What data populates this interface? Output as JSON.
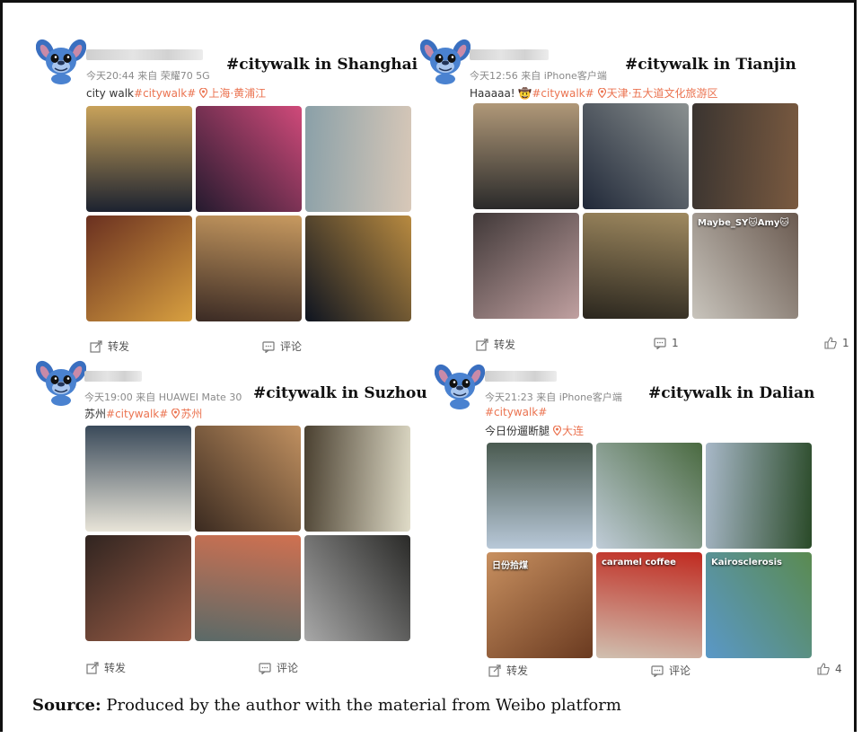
{
  "posts": [
    {
      "id": "shanghai",
      "title": "#citywalk in Shanghai",
      "meta": "今天20:44  来自 荣耀70 5G",
      "text_prefix": "city walk",
      "tag": "#citywalk#",
      "location": "上海·黄浦江",
      "photos": [
        {
          "colors": [
            "#1c2230",
            "#c8a25a"
          ],
          "caption": ""
        },
        {
          "colors": [
            "#241a2e",
            "#d04a7a"
          ],
          "caption": ""
        },
        {
          "colors": [
            "#8aa0a8",
            "#d8c8b8"
          ],
          "caption": ""
        },
        {
          "colors": [
            "#6a3020",
            "#d8a040"
          ],
          "caption": ""
        },
        {
          "colors": [
            "#3a2a24",
            "#c89a60"
          ],
          "caption": ""
        },
        {
          "colors": [
            "#0e1420",
            "#b88a40"
          ],
          "caption": ""
        }
      ],
      "actions": {
        "repost": "转发",
        "comment": "评论",
        "like": ""
      }
    },
    {
      "id": "tianjin",
      "title": "#citywalk in Tianjin",
      "meta": "今天12:56  来自 iPhone客户端",
      "text_prefix": "Haaaaa!  🤠",
      "tag": "#citywalk#",
      "location": "天津·五大道文化旅游区",
      "photos": [
        {
          "colors": [
            "#2a2a2a",
            "#b09878"
          ],
          "caption": ""
        },
        {
          "colors": [
            "#202838",
            "#8a9090"
          ],
          "caption": ""
        },
        {
          "colors": [
            "#3a3430",
            "#7a5a40"
          ],
          "caption": ""
        },
        {
          "colors": [
            "#403838",
            "#c0a0a0"
          ],
          "caption": ""
        },
        {
          "colors": [
            "#2a261e",
            "#a08a60"
          ],
          "caption": ""
        },
        {
          "colors": [
            "#c8c4bc",
            "#6a5a50"
          ],
          "caption": "Maybe_SY🐱Amy🐱"
        }
      ],
      "actions": {
        "repost": "转发",
        "comment": "1",
        "like": "1"
      }
    },
    {
      "id": "suzhou",
      "title": "#citywalk in Suzhou",
      "meta": "今天19:00  来自 HUAWEI Mate 30",
      "text_prefix": "苏州",
      "tag": "#citywalk#",
      "location": "苏州",
      "photos": [
        {
          "colors": [
            "#e8e4d8",
            "#3a4a5a"
          ],
          "caption": ""
        },
        {
          "colors": [
            "#3a2a20",
            "#c09060"
          ],
          "caption": ""
        },
        {
          "colors": [
            "#4a4030",
            "#e0dcc8"
          ],
          "caption": ""
        },
        {
          "colors": [
            "#302420",
            "#a06048"
          ],
          "caption": ""
        },
        {
          "colors": [
            "#5a6a68",
            "#d07050"
          ],
          "caption": ""
        },
        {
          "colors": [
            "#a8a8a8",
            "#2a2a28"
          ],
          "caption": ""
        }
      ],
      "actions": {
        "repost": "转发",
        "comment": "评论",
        "like": ""
      }
    },
    {
      "id": "dalian",
      "title": "#citywalk in Dalian",
      "meta": "今天21:23  来自 iPhone客户端",
      "text_prefix": "",
      "tag": "#citywalk#",
      "line2": "今日份遛断腿",
      "location": "大连",
      "photos": [
        {
          "colors": [
            "#b8c8d8",
            "#4a5a50"
          ],
          "caption": ""
        },
        {
          "colors": [
            "#c0ccd8",
            "#4a6a40"
          ],
          "caption": ""
        },
        {
          "colors": [
            "#a8b8c8",
            "#2a4a28"
          ],
          "caption": ""
        },
        {
          "colors": [
            "#c89060",
            "#6a3a20"
          ],
          "caption": "日份拾煤"
        },
        {
          "colors": [
            "#d0c0b0",
            "#c02a20"
          ],
          "caption": "caramel coffee"
        },
        {
          "colors": [
            "#5a98c8",
            "#5a8a50"
          ],
          "caption": "Kairosclerosis"
        }
      ],
      "actions": {
        "repost": "转发",
        "comment": "评论",
        "like": "4"
      }
    }
  ],
  "source": {
    "label": "Source:",
    "text": " Produced by the author with the material from Weibo platform"
  }
}
